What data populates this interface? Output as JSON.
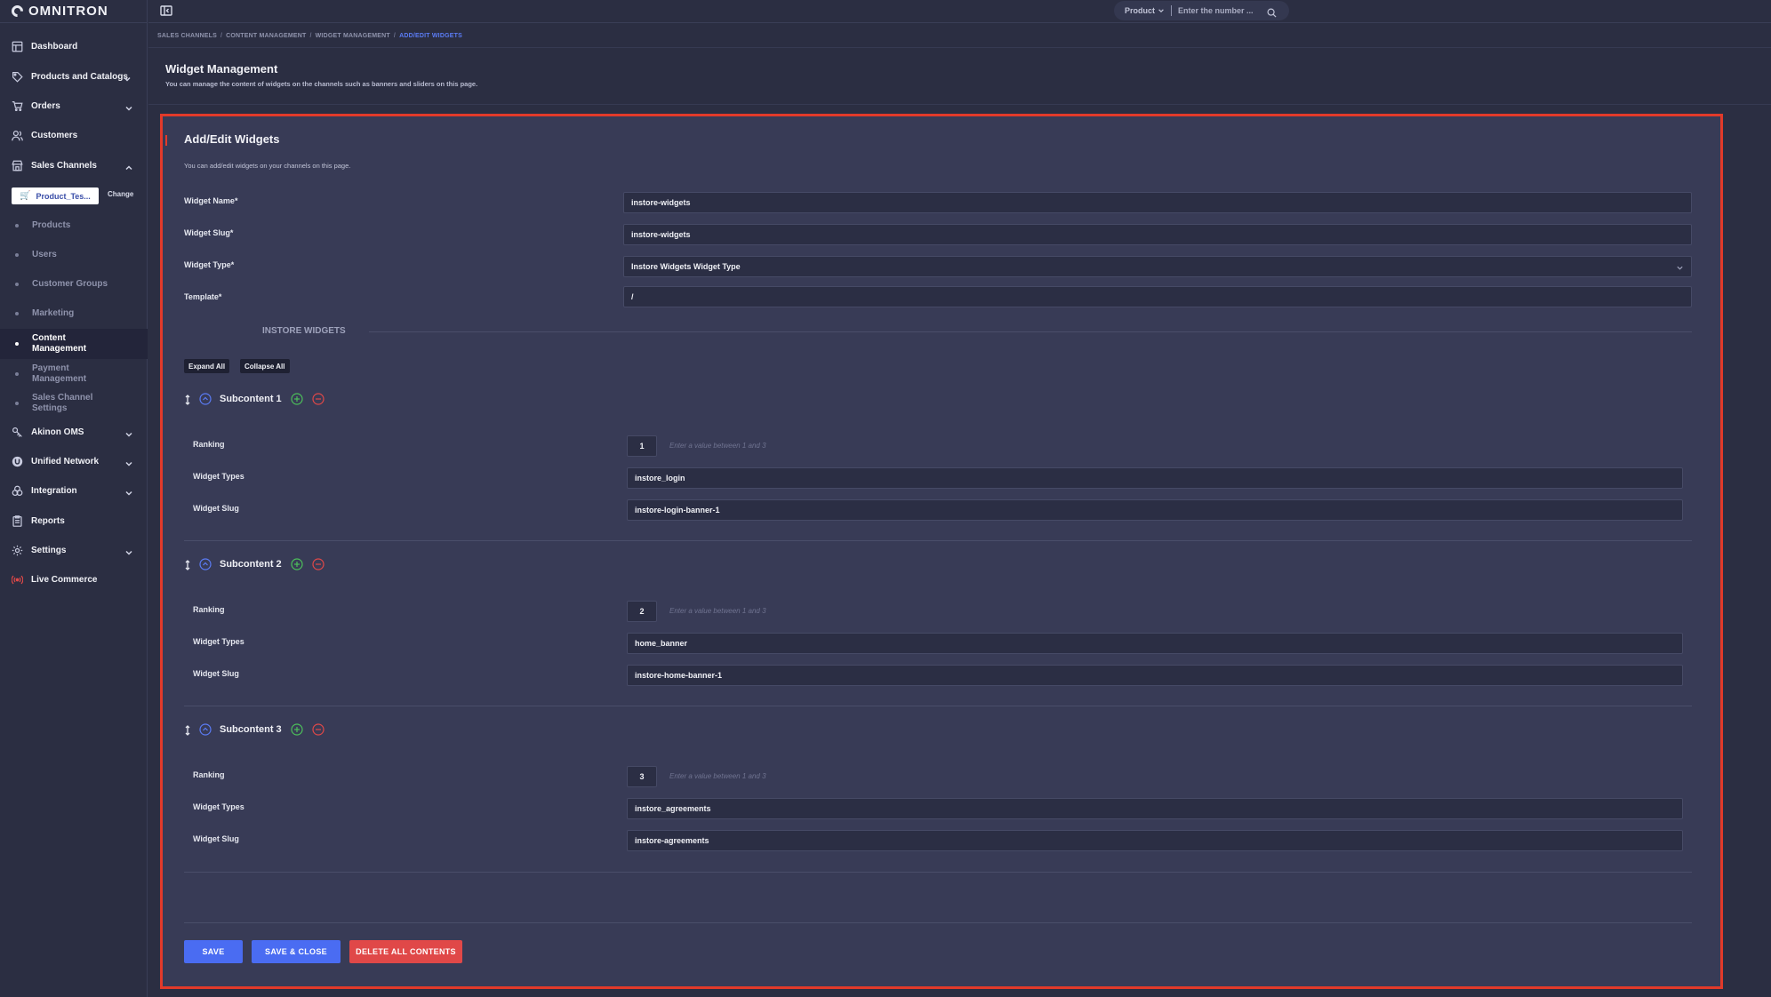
{
  "app": {
    "logo": "OMNITRON"
  },
  "sidebar": {
    "items": [
      {
        "label": "Dashboard",
        "icon": "dashboard-icon",
        "chevron": false
      },
      {
        "label": "Products and Catalogs",
        "icon": "tag-icon",
        "chevron": true
      },
      {
        "label": "Orders",
        "icon": "cart-icon",
        "chevron": true
      },
      {
        "label": "Customers",
        "icon": "users-icon",
        "chevron": false
      },
      {
        "label": "Sales Channels",
        "icon": "store-icon",
        "chevron": true,
        "expanded": true
      }
    ],
    "channel": {
      "name": "Product_Tes...",
      "change": "Change"
    },
    "sub_items": [
      {
        "label": "Products"
      },
      {
        "label": "Users"
      },
      {
        "label": "Customer Groups"
      },
      {
        "label": "Marketing"
      },
      {
        "label": "Content Management",
        "active": true
      },
      {
        "label": "Payment Management"
      },
      {
        "label": "Sales Channel Settings"
      }
    ],
    "items_bottom": [
      {
        "label": "Akinon OMS",
        "icon": "oms-icon",
        "chevron": true
      },
      {
        "label": "Unified Network",
        "icon": "network-icon",
        "chevron": true
      },
      {
        "label": "Integration",
        "icon": "integration-icon",
        "chevron": true
      },
      {
        "label": "Reports",
        "icon": "reports-icon",
        "chevron": false
      },
      {
        "label": "Settings",
        "icon": "gear-icon",
        "chevron": true
      },
      {
        "label": "Live Commerce",
        "icon": "broadcast-icon",
        "chevron": false
      }
    ]
  },
  "topbar": {
    "search_category": "Product",
    "search_placeholder": "Enter the number ..."
  },
  "breadcrumb": [
    "SALES CHANNELS",
    "CONTENT MANAGEMENT",
    "WIDGET MANAGEMENT",
    "ADD/EDIT WIDGETS"
  ],
  "page": {
    "title": "Widget Management",
    "description": "You can manage the content of widgets on the channels such as banners and sliders on this page."
  },
  "panel": {
    "title": "Add/Edit Widgets",
    "description": "You can add/edit widgets on your channels on this page.",
    "fields": {
      "widget_name": {
        "label": "Widget Name",
        "value": "instore-widgets"
      },
      "widget_slug": {
        "label": "Widget Slug",
        "value": "instore-widgets"
      },
      "widget_type": {
        "label": "Widget Type",
        "value": "Instore Widgets Widget Type"
      },
      "template": {
        "label": "Template",
        "value": "/"
      }
    },
    "required_mark": "*",
    "section_title": "INSTORE WIDGETS",
    "expand_all": "Expand All",
    "collapse_all": "Collapse All",
    "row_labels": {
      "ranking": "Ranking",
      "widget_types": "Widget Types",
      "widget_slug": "Widget Slug"
    },
    "rank_hint": "Enter a value between 1 and 3",
    "subcontents": [
      {
        "title": "Subcontent 1",
        "ranking": "1",
        "widget_types": "instore_login",
        "widget_slug": "instore-login-banner-1"
      },
      {
        "title": "Subcontent 2",
        "ranking": "2",
        "widget_types": "home_banner",
        "widget_slug": "instore-home-banner-1"
      },
      {
        "title": "Subcontent 3",
        "ranking": "3",
        "widget_types": "instore_agreements",
        "widget_slug": "instore-agreements"
      }
    ],
    "buttons": {
      "save": "SAVE",
      "save_close": "SAVE & CLOSE",
      "delete_all": "DELETE ALL CONTENTS"
    }
  },
  "colors": {
    "accent": "#4a6cf2",
    "danger": "#e04848",
    "highlight": "#e23a2a",
    "success": "#4cbf5a"
  }
}
